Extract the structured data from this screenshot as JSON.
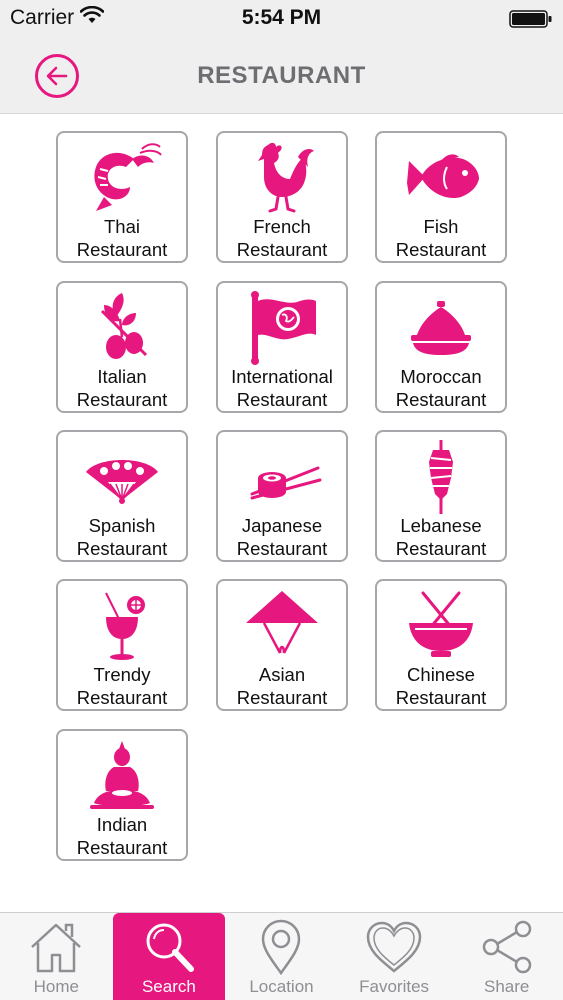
{
  "status_bar": {
    "carrier": "Carrier",
    "time": "5:54 PM"
  },
  "nav": {
    "title": "RESTAURANT",
    "back_icon": "arrow-left-icon"
  },
  "accent_color": "#e6177f",
  "restaurants": [
    {
      "line1": "Thai",
      "line2": "Restaurant",
      "icon": "shrimp-icon"
    },
    {
      "line1": "French",
      "line2": "Restaurant",
      "icon": "rooster-icon"
    },
    {
      "line1": "Fish",
      "line2": "Restaurant",
      "icon": "fish-icon"
    },
    {
      "line1": "Italian",
      "line2": "Restaurant",
      "icon": "olive-icon"
    },
    {
      "line1": "International",
      "line2": "Restaurant",
      "icon": "globe-flag-icon"
    },
    {
      "line1": "Moroccan",
      "line2": "Restaurant",
      "icon": "tajine-icon"
    },
    {
      "line1": "Spanish",
      "line2": "Restaurant",
      "icon": "hand-fan-icon"
    },
    {
      "line1": "Japanese",
      "line2": "Restaurant",
      "icon": "sushi-chopsticks-icon"
    },
    {
      "line1": "Lebanese",
      "line2": "Restaurant",
      "icon": "shawarma-icon"
    },
    {
      "line1": "Trendy",
      "line2": "Restaurant",
      "icon": "cocktail-icon"
    },
    {
      "line1": "Asian",
      "line2": "Restaurant",
      "icon": "conical-hat-icon"
    },
    {
      "line1": "Chinese",
      "line2": "Restaurant",
      "icon": "bowl-chopsticks-icon"
    },
    {
      "line1": "Indian",
      "line2": "Restaurant",
      "icon": "buddha-icon"
    }
  ],
  "tabs": [
    {
      "label": "Home",
      "icon": "home-icon",
      "active": false
    },
    {
      "label": "Search",
      "icon": "search-icon",
      "active": true
    },
    {
      "label": "Location",
      "icon": "location-pin-icon",
      "active": false
    },
    {
      "label": "Favorites",
      "icon": "heart-icon",
      "active": false
    },
    {
      "label": "Share",
      "icon": "share-icon",
      "active": false
    }
  ]
}
